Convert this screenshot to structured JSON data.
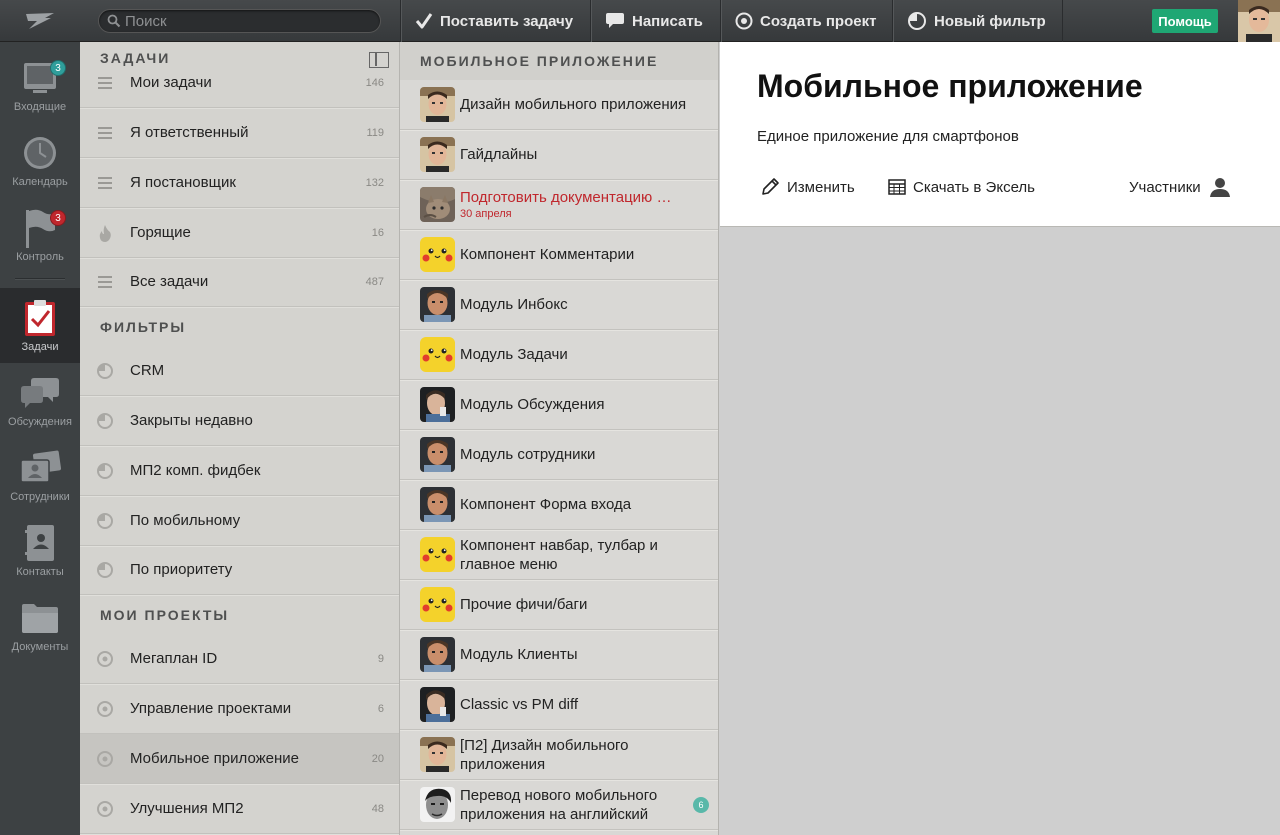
{
  "topbar": {
    "search_placeholder": "Поиск",
    "actions": [
      {
        "label": "Поставить задачу",
        "icon": "checkmark-icon"
      },
      {
        "label": "Написать",
        "icon": "speech-bubble-icon"
      },
      {
        "label": "Создать проект",
        "icon": "target-icon"
      },
      {
        "label": "Новый фильтр",
        "icon": "pie-chart-icon"
      }
    ],
    "help_label": "Помощь"
  },
  "leftnav": [
    {
      "label": "Входящие",
      "icon": "inbox-icon",
      "badge": "3",
      "badge_color": "#2f9e9b"
    },
    {
      "label": "Календарь",
      "icon": "clock-icon"
    },
    {
      "label": "Контроль",
      "icon": "flag-icon",
      "badge": "3",
      "badge_color": "#c0272d"
    },
    {
      "label": "Задачи",
      "icon": "clipboard-check-icon",
      "active": true
    },
    {
      "label": "Обсуждения",
      "icon": "chat-bubbles-icon"
    },
    {
      "label": "Сотрудники",
      "icon": "id-cards-icon"
    },
    {
      "label": "Контакты",
      "icon": "contact-book-icon"
    },
    {
      "label": "Документы",
      "icon": "folder-icon"
    }
  ],
  "sidebar": {
    "tasks_heading": "ЗАДАЧИ",
    "tasks": [
      {
        "label": "Мои задачи",
        "count": "146"
      },
      {
        "label": "Я ответственный",
        "count": "119"
      },
      {
        "label": "Я постановщик",
        "count": "132"
      },
      {
        "label": "Горящие",
        "count": "16"
      },
      {
        "label": "Все задачи",
        "count": "487"
      }
    ],
    "filters_heading": "ФИЛЬТРЫ",
    "filters": [
      {
        "label": "CRM"
      },
      {
        "label": "Закрыты недавно"
      },
      {
        "label": "МП2 комп. фидбек"
      },
      {
        "label": "По мобильному"
      },
      {
        "label": "По приоритету"
      }
    ],
    "projects_heading": "МОИ ПРОЕКТЫ",
    "projects": [
      {
        "label": "Мегаплан ID",
        "count": "9"
      },
      {
        "label": "Управление проектами",
        "count": "6"
      },
      {
        "label": "Мобильное приложение",
        "count": "20",
        "selected": true
      },
      {
        "label": "Улучшения МП2",
        "count": "48"
      }
    ]
  },
  "tasklist": {
    "heading": "МОБИЛЬНОЕ ПРИЛОЖЕНИЕ",
    "items": [
      {
        "title": "Дизайн мобильного приложения",
        "avatar": "man"
      },
      {
        "title": "Гайдлайны",
        "avatar": "man"
      },
      {
        "title": "Подготовить документацию …",
        "subtitle": "30 апреля",
        "overdue": true,
        "avatar": "cat"
      },
      {
        "title": "Компонент Комментарии",
        "avatar": "pikachu"
      },
      {
        "title": "Модуль Инбокс",
        "avatar": "man2"
      },
      {
        "title": "Модуль Задачи",
        "avatar": "pikachu"
      },
      {
        "title": "Модуль Обсуждения",
        "avatar": "man3"
      },
      {
        "title": "Модуль сотрудники",
        "avatar": "man2"
      },
      {
        "title": "Компонент Форма входа",
        "avatar": "man2"
      },
      {
        "title": "Компонент навбар, тулбар и главное меню",
        "avatar": "pikachu"
      },
      {
        "title": "Прочие фичи/баги",
        "avatar": "pikachu"
      },
      {
        "title": "Модуль Клиенты",
        "avatar": "man2"
      },
      {
        "title": "Classic vs PM diff",
        "avatar": "man3"
      },
      {
        "title": "[П2] Дизайн мобильного приложения",
        "avatar": "man"
      },
      {
        "title": "Перевод нового мобильного приложения на английский",
        "avatar": "bw",
        "badge": "6"
      }
    ]
  },
  "detail": {
    "title": "Мобильное приложение",
    "description": "Единое приложение для смартфонов",
    "edit_label": "Изменить",
    "excel_label": "Скачать в Эксель",
    "members_label": "Участники"
  },
  "colors": {
    "accent_green": "#1fa774",
    "overdue_red": "#c0272d",
    "badge_teal": "#2f9e9b"
  }
}
